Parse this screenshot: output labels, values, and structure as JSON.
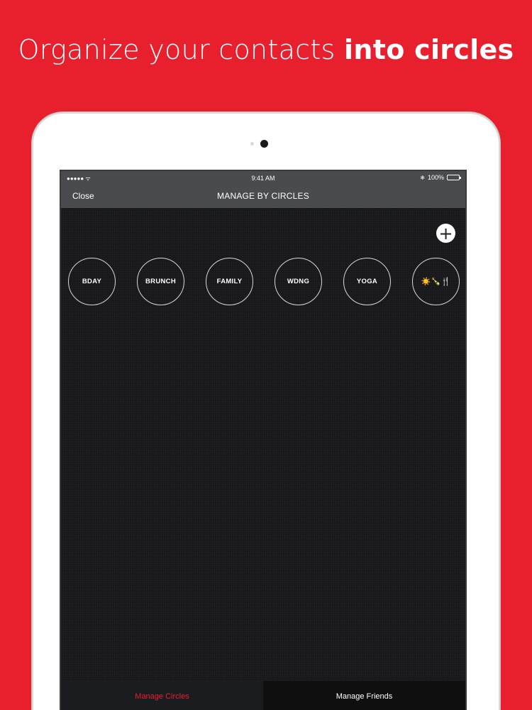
{
  "headline": {
    "regular": "Organize your contacts ",
    "bold": "into circles"
  },
  "status_bar": {
    "signal": "●●●●● ᯤ",
    "time": "9:41 AM",
    "battery": "100%"
  },
  "nav": {
    "close_label": "Close",
    "title": "MANAGE BY CIRCLES"
  },
  "add_button": "+",
  "circles": [
    {
      "label": "BDAY"
    },
    {
      "label": "BRUNCH"
    },
    {
      "label": "FAMILY"
    },
    {
      "label": "WDNG"
    },
    {
      "label": "YOGA"
    },
    {
      "label": "☀️🍾🍴"
    }
  ],
  "tabs": [
    {
      "label": "Manage Circles",
      "active": true
    },
    {
      "label": "Manage Friends",
      "active": false
    }
  ],
  "colors": {
    "background": "#e8202e",
    "accent": "#e8202e",
    "screen": "#17181b",
    "navbar": "#4a4b4f"
  }
}
